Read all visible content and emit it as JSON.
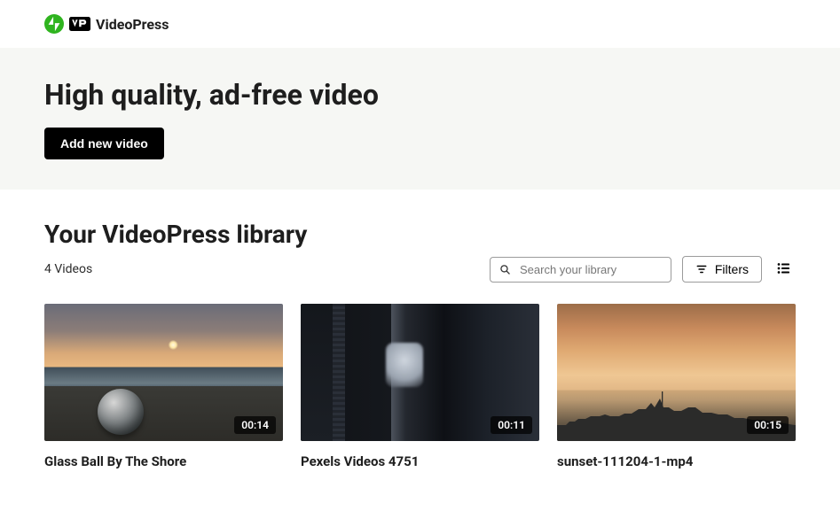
{
  "brand": {
    "name": "VideoPress"
  },
  "hero": {
    "title": "High quality, ad-free video",
    "add_button": "Add new video"
  },
  "library": {
    "title": "Your VideoPress library",
    "count_label": "4 Videos",
    "search_placeholder": "Search your library",
    "filters_label": "Filters",
    "videos": [
      {
        "title": "Glass Ball By The Shore",
        "duration": "00:14"
      },
      {
        "title": "Pexels Videos 4751",
        "duration": "00:11"
      },
      {
        "title": "sunset-111204-1-mp4",
        "duration": "00:15"
      }
    ]
  }
}
